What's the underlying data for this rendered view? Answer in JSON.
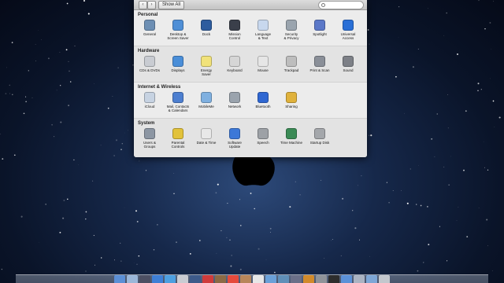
{
  "toolbar": {
    "back_label": "‹",
    "forward_label": "›",
    "show_all_label": "Show All",
    "search_placeholder": ""
  },
  "sections": [
    {
      "title": "Personal",
      "items": [
        {
          "label": "General",
          "icon": "general-icon",
          "color": "#6d8fb4"
        },
        {
          "label": "Desktop &\nScreen Saver",
          "icon": "desktop-icon",
          "color": "#4f8fd6"
        },
        {
          "label": "Dock",
          "icon": "dock-icon",
          "color": "#2d5c9e"
        },
        {
          "label": "Mission\nControl",
          "icon": "mission-control-icon",
          "color": "#3a3f4a"
        },
        {
          "label": "Language\n& Text",
          "icon": "flag-icon",
          "color": "#c8d8ee"
        },
        {
          "label": "Security\n& Privacy",
          "icon": "house-icon",
          "color": "#9aa4ae"
        },
        {
          "label": "Spotlight",
          "icon": "spotlight-icon",
          "color": "#5b78c8"
        },
        {
          "label": "Universal\nAccess",
          "icon": "universal-access-icon",
          "color": "#2a6fd6"
        }
      ]
    },
    {
      "title": "Hardware",
      "items": [
        {
          "label": "CDs & DVDs",
          "icon": "cd-icon",
          "color": "#c9ccd2"
        },
        {
          "label": "Displays",
          "icon": "display-icon",
          "color": "#4a8ed8"
        },
        {
          "label": "Energy\nSaver",
          "icon": "bulb-icon",
          "color": "#f1e27a"
        },
        {
          "label": "Keyboard",
          "icon": "keyboard-icon",
          "color": "#d6d6d6"
        },
        {
          "label": "Mouse",
          "icon": "mouse-icon",
          "color": "#e6e6e6"
        },
        {
          "label": "Trackpad",
          "icon": "trackpad-icon",
          "color": "#bdbdbd"
        },
        {
          "label": "Print & Scan",
          "icon": "printer-icon",
          "color": "#8a8f98"
        },
        {
          "label": "Sound",
          "icon": "speaker-icon",
          "color": "#7d8087"
        }
      ]
    },
    {
      "title": "Internet & Wireless",
      "items": [
        {
          "label": "iCloud",
          "icon": "cloud-icon",
          "color": "#c7d3e2"
        },
        {
          "label": "Mail, Contacts\n& Calendars",
          "icon": "at-icon",
          "color": "#4d7fd0"
        },
        {
          "label": "MobileMe",
          "icon": "mobileme-icon",
          "color": "#7fb0e0"
        },
        {
          "label": "Network",
          "icon": "globe-icon",
          "color": "#9aa3ad"
        },
        {
          "label": "Bluetooth",
          "icon": "bluetooth-icon",
          "color": "#2f67d2"
        },
        {
          "label": "Sharing",
          "icon": "sharing-icon",
          "color": "#e0b23c"
        }
      ]
    },
    {
      "title": "System",
      "items": [
        {
          "label": "Users &\nGroups",
          "icon": "users-icon",
          "color": "#8c96a3"
        },
        {
          "label": "Parental\nControls",
          "icon": "parental-icon",
          "color": "#e2c23a"
        },
        {
          "label": "Date & Time",
          "icon": "clock-icon",
          "color": "#e8e8e8"
        },
        {
          "label": "Software\nUpdate",
          "icon": "software-update-icon",
          "color": "#3c78d8"
        },
        {
          "label": "Speech",
          "icon": "microphone-icon",
          "color": "#9da1a6"
        },
        {
          "label": "Time Machine",
          "icon": "time-machine-icon",
          "color": "#3a8a55"
        },
        {
          "label": "Startup Disk",
          "icon": "disk-icon",
          "color": "#a4a7ab"
        }
      ]
    }
  ],
  "dock": {
    "items": [
      {
        "icon": "finder-icon",
        "color": "#5b8fd6"
      },
      {
        "icon": "launchpad-icon",
        "color": "#9bb7d9"
      },
      {
        "icon": "mission-control-icon",
        "color": "#4c4f63"
      },
      {
        "icon": "app-store-icon",
        "color": "#3e7fd6"
      },
      {
        "icon": "safari-icon",
        "color": "#4d9fe0"
      },
      {
        "icon": "mail-icon",
        "color": "#c9ccd2"
      },
      {
        "icon": "facetime-icon",
        "color": "#3d5a8a"
      },
      {
        "icon": "itunes-icon",
        "color": "#cf3b3b"
      },
      {
        "icon": "photo-icon",
        "color": "#8b6a45"
      },
      {
        "icon": "calendar-icon",
        "color": "#e54a3c"
      },
      {
        "icon": "contacts-icon",
        "color": "#b8865a"
      },
      {
        "icon": "ical-icon",
        "color": "#e7e7e7"
      },
      {
        "icon": "preview-icon",
        "color": "#6aa0d8"
      },
      {
        "icon": "iphoto-icon",
        "color": "#5f8fb8"
      },
      {
        "icon": "imovie-icon",
        "color": "#6a6f88"
      },
      {
        "icon": "garageband-icon",
        "color": "#d18a2b"
      },
      {
        "icon": "system-preferences-icon",
        "color": "#8f9399"
      },
      {
        "icon": "terminal-icon",
        "color": "#2d2d2d"
      },
      {
        "icon": "downloads-icon",
        "color": "#5b91d8"
      },
      {
        "icon": "documents-icon",
        "color": "#aab3c2"
      },
      {
        "icon": "applications-icon",
        "color": "#7da6d6"
      },
      {
        "icon": "trash-icon",
        "color": "#c2c7cd"
      }
    ]
  }
}
